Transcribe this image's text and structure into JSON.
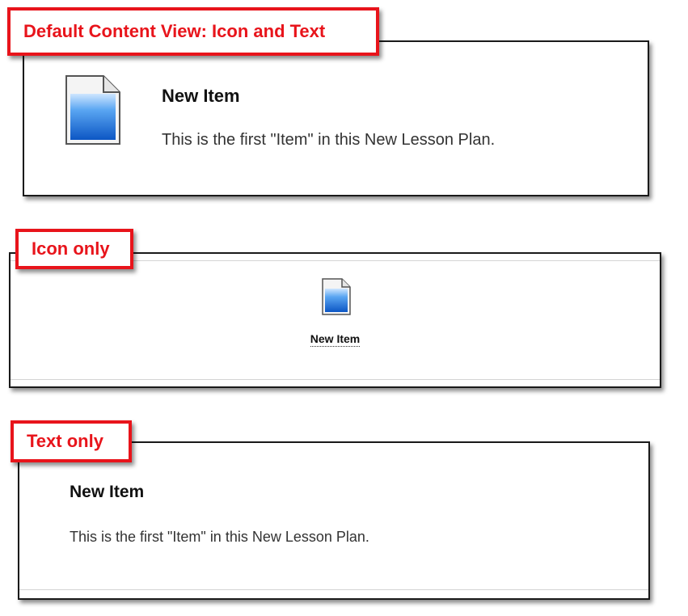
{
  "labels": {
    "default_view": "Default Content View: Icon and Text",
    "icon_only": "Icon only",
    "text_only": "Text only"
  },
  "item": {
    "title": "New Item",
    "description": "This is the first \"Item\" in this New Lesson Plan."
  },
  "colors": {
    "label_red": "#e8141b",
    "icon_blue": "#1f6fd6",
    "panel_border": "#1a1a1a"
  },
  "icons": {
    "document": "document-icon"
  }
}
